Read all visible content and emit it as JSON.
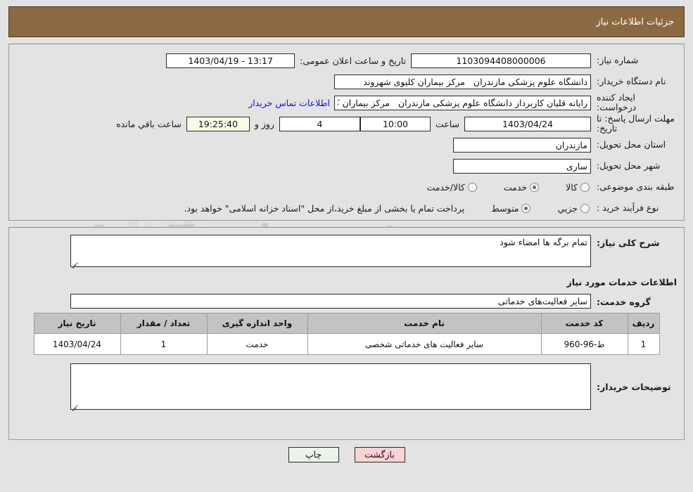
{
  "header": {
    "title": "جزئیات اطلاعات نیاز"
  },
  "info": {
    "need_number_label": "شماره نیاز:",
    "need_number_value": "1103094408000006",
    "announce_label": "تاریخ و ساعت اعلان عمومی:",
    "announce_value": "1403/04/19 - 13:17",
    "buyer_org_label": "نام دستگاه خریدار:",
    "buyer_org_value": "دانشگاه علوم پزشکی مازندران   مرکز بیماران کلیوی شهروند",
    "creator_label": "ایجاد کننده درخواست:",
    "creator_value": "رایانه قلیان کاربرداز دانشگاه علوم پزشکی مازندران   مرکز بیماران کلیوی شهروند",
    "contact_link": "اطلاعات تماس خریدار",
    "deadline_label": "مهلت ارسال پاسخ: تا تاریخ:",
    "deadline_date": "1403/04/24",
    "deadline_time_label": "ساعت",
    "deadline_time": "10:00",
    "remaining_days": "4",
    "days_and_label": "روز و",
    "remaining_time": "19:25:40",
    "remaining_suffix": "ساعت باقي مانده",
    "province_label": "استان محل تحویل:",
    "province_value": "مازندران",
    "city_label": "شهر محل تحویل:",
    "city_value": "ساری",
    "category_label": "طبقه بندی موضوعی:",
    "category_options": [
      {
        "label": "کالا",
        "selected": false
      },
      {
        "label": "خدمت",
        "selected": true
      },
      {
        "label": "کالا/خدمت",
        "selected": false
      }
    ],
    "process_label": "نوع فرآیند خرید :",
    "process_options": [
      {
        "label": "جزیي",
        "selected": false
      },
      {
        "label": "متوسط",
        "selected": true
      }
    ],
    "payment_note": "پرداخت تمام یا بخشی از مبلغ خرید،از محل \"اسناد خزانه اسلامی\" خواهد بود."
  },
  "detail": {
    "general_desc_label": "شرح کلی نیاز:",
    "general_desc_value": "تمام برگه ها امضاء شود",
    "services_section_title": "اطلاعات خدمات مورد نیاز",
    "service_group_label": "گروه خدمت:",
    "service_group_value": "سایر فعالیت‌های خدماتی",
    "table": {
      "columns": [
        "ردیف",
        "کد خدمت",
        "نام خدمت",
        "واحد اندازه گیری",
        "تعداد / مقدار",
        "تاریخ نیاز"
      ],
      "rows": [
        {
          "row": "1",
          "code": "ط-96-960",
          "name": "سایر فعالیت های خدماتی شخصی",
          "unit": "خدمت",
          "quantity": "1",
          "need_date": "1403/04/24"
        }
      ]
    },
    "buyer_notes_label": "توضیحات خریدار:",
    "buyer_notes_value": ""
  },
  "buttons": {
    "print": "چاپ",
    "back": "بازگشت"
  },
  "watermark": {
    "text": "AnaTender.net"
  },
  "colors": {
    "header_bg": "#8b6a43",
    "panel_bg": "#e3e3e3",
    "link": "#1515d6",
    "print_btn": "#e8f6e8",
    "back_btn": "#fbd3d3",
    "countdown_bg": "#fbfbe7",
    "table_header_bg": "#c3c3c3"
  }
}
